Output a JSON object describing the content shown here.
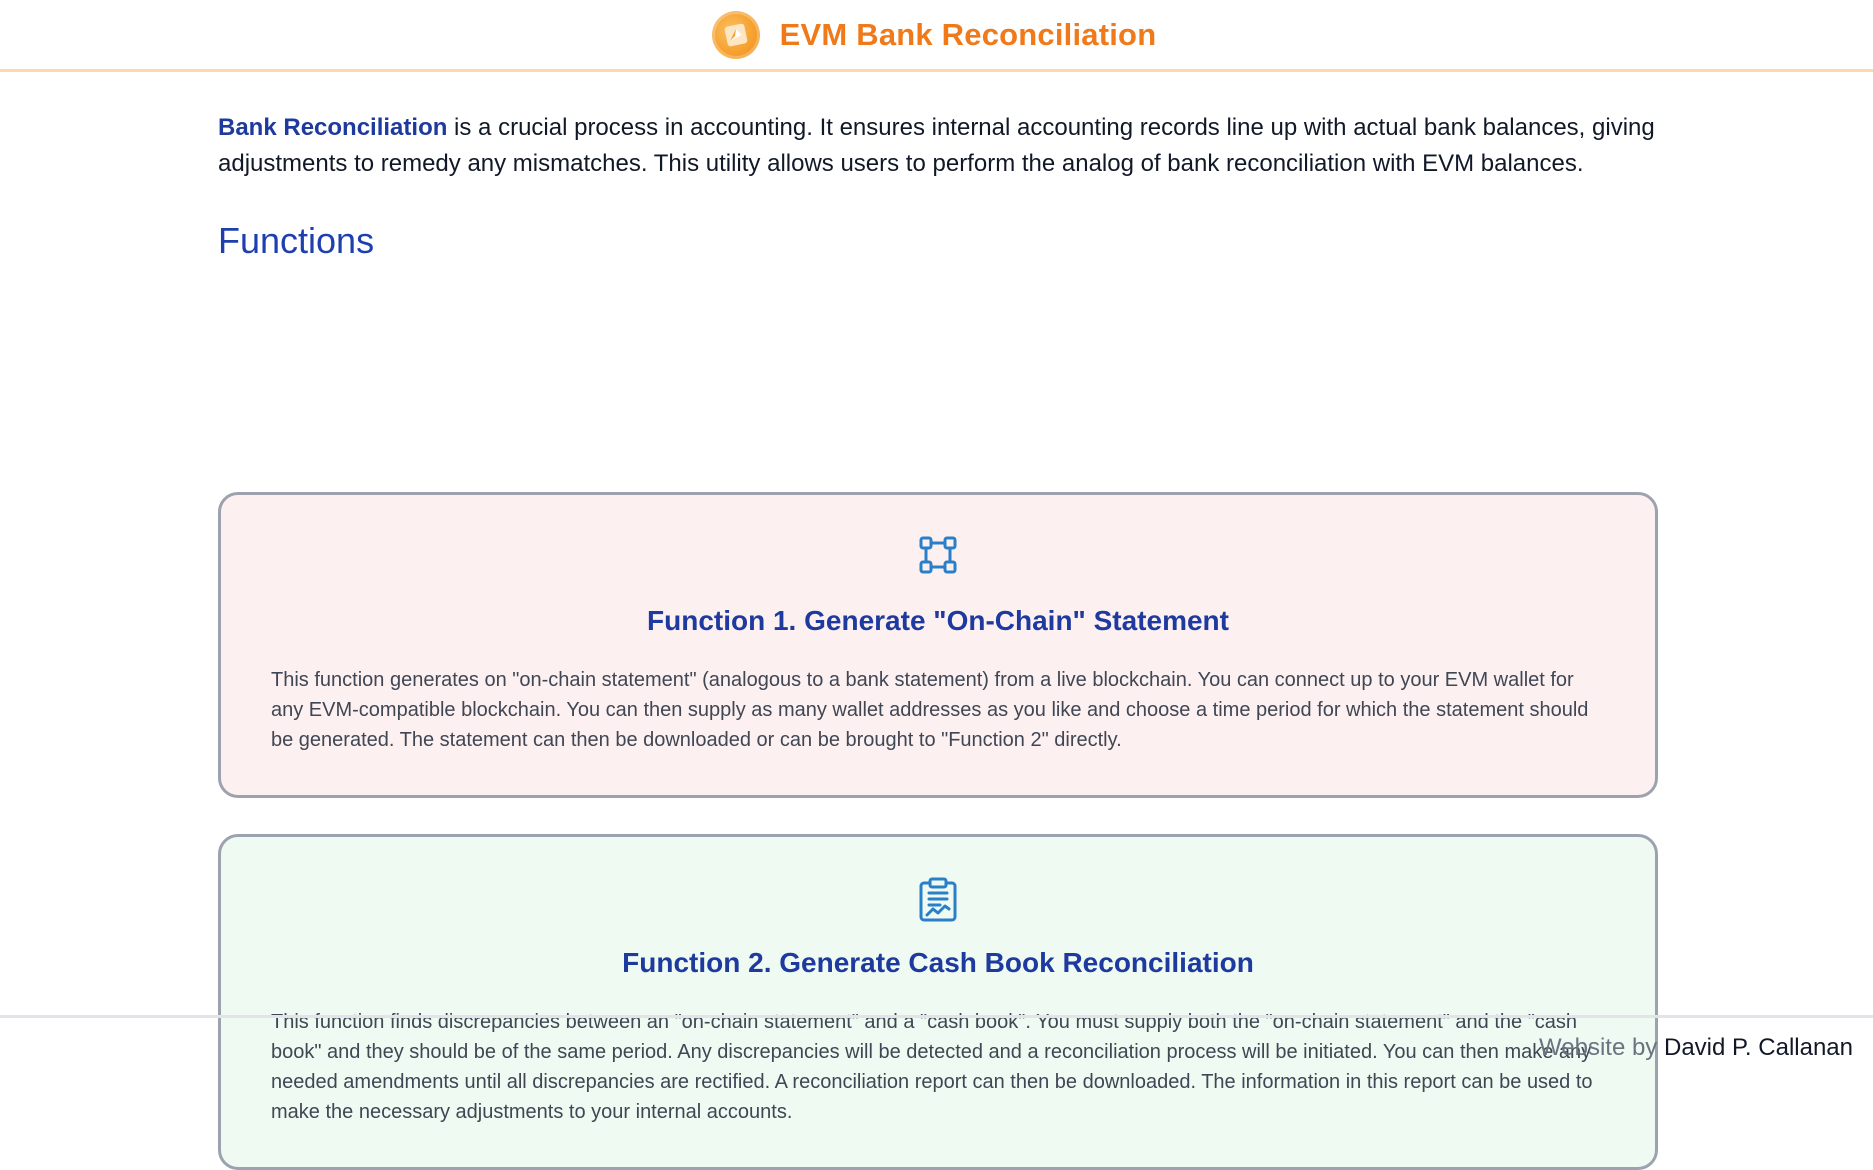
{
  "header": {
    "title": "EVM Bank Reconciliation",
    "logo_icon": "compass-icon",
    "accent_color": "#f07a1a"
  },
  "intro": {
    "highlight": "Bank Reconciliation",
    "text": " is a crucial process in accounting. It ensures internal accounting records line up with actual bank balances, giving adjustments to remedy any mismatches. This utility allows users to perform the analog of bank reconciliation with EVM balances."
  },
  "functions": {
    "heading": "Functions",
    "items": [
      {
        "icon": "network-nodes-icon",
        "title": "Function 1. Generate \"On-Chain\" Statement",
        "description": "This function generates on \"on-chain statement\" (analogous to a bank statement) from a live blockchain. You can connect up to your EVM wallet for any EVM-compatible blockchain. You can then supply as many wallet addresses as you like and choose a time period for which the statement should be generated. The statement can then be downloaded or can be brought to \"Function 2\" directly.",
        "background": "#fdf0f0"
      },
      {
        "icon": "clipboard-chart-icon",
        "title": "Function 2. Generate Cash Book Reconciliation",
        "description": "This function finds discrepancies between an \"on-chain statement\" and a \"cash book\". You must supply both the \"on-chain statement\" and the \"cash book\" and they should be of the same period. Any discrepancies will be detected and a reconciliation process will be initiated. You can then make any needed amendments until all discrepancies are rectified. A reconciliation report can then be downloaded. The information in this report can be used to make the necessary adjustments to your internal accounts.",
        "background": "#effaf2"
      }
    ]
  },
  "footer": {
    "prefix": "Website by ",
    "author": "David P. Callanan"
  }
}
